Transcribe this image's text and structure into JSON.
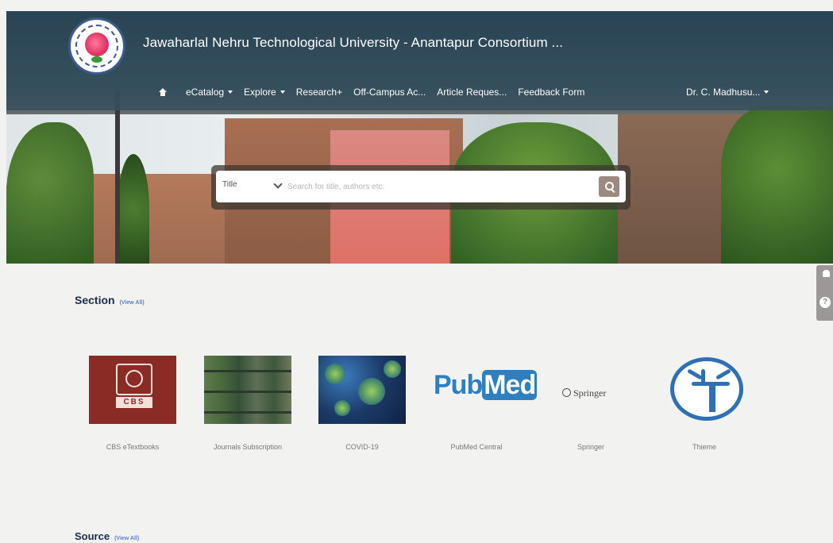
{
  "header": {
    "university_title": "Jawaharlal Nehru Technological University - Anantapur Consortium ...",
    "logo_text": "JAWAHARLAL NEHRU TECHNOLOGICAL UNIVERSITY ANANTAPUR"
  },
  "nav": {
    "items": [
      {
        "label": "eCatalog",
        "dropdown": true
      },
      {
        "label": "Explore",
        "dropdown": true
      },
      {
        "label": "Research+",
        "dropdown": false
      },
      {
        "label": "Off-Campus Ac...",
        "dropdown": false
      },
      {
        "label": "Article Reques...",
        "dropdown": false
      },
      {
        "label": "Feedback Form",
        "dropdown": false
      }
    ],
    "user": "Dr. C. Madhusu..."
  },
  "search": {
    "type_selected": "Title",
    "placeholder": "Search for title, authors etc."
  },
  "section": {
    "title": "Section",
    "view_all": "(View All)",
    "items": [
      {
        "label": "CBS eTextbooks",
        "thumb_text": "CBS"
      },
      {
        "label": "Journals Subscription"
      },
      {
        "label": "COVID-19"
      },
      {
        "label": "PubMed Central",
        "thumb_text_a": "Pub",
        "thumb_text_b": "Med"
      },
      {
        "label": "Springer",
        "thumb_text": "Springer"
      },
      {
        "label": "Thieme"
      }
    ]
  },
  "source": {
    "title": "Source",
    "view_all": "(View All)"
  },
  "colors": {
    "header_overlay": "#35566c",
    "title_navy": "#1a2c4e",
    "link_blue": "#5b7fc4",
    "pubmed_blue": "#2d7fc0",
    "cbs_red": "#8a2b26"
  }
}
